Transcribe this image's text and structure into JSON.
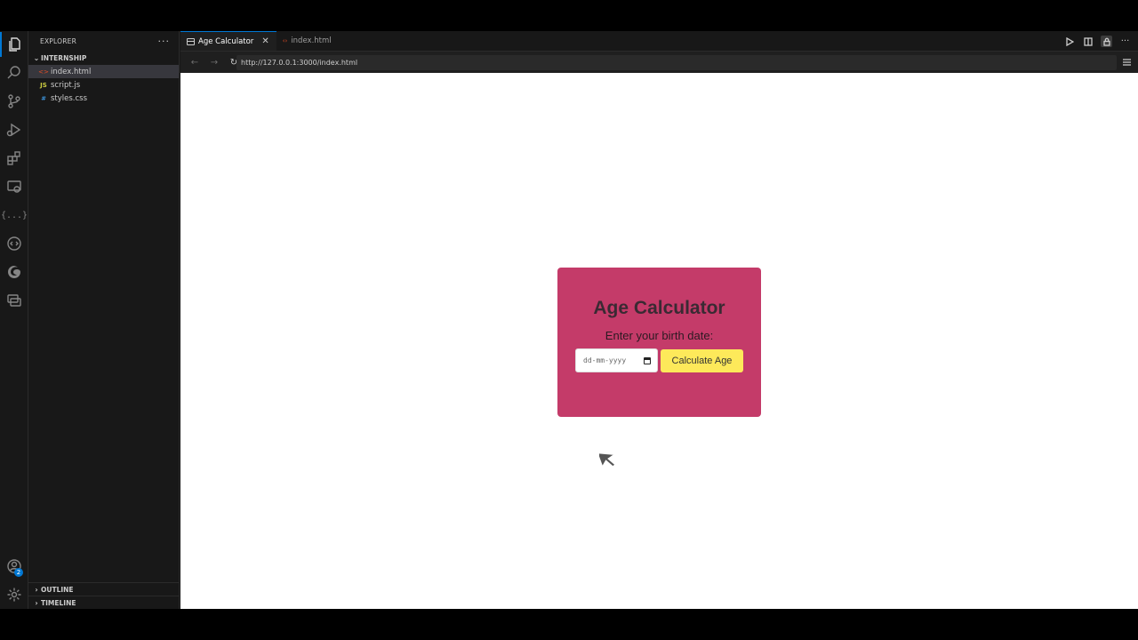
{
  "sidebar": {
    "title": "EXPLORER",
    "more_label": "···",
    "folder": "INTERNSHIP",
    "files": [
      {
        "name": "index.html",
        "icon": "html-file-icon",
        "glyph": "<>"
      },
      {
        "name": "script.js",
        "icon": "js-file-icon",
        "glyph": "JS"
      },
      {
        "name": "styles.css",
        "icon": "css-file-icon",
        "glyph": "#"
      }
    ],
    "outline": "OUTLINE",
    "timeline": "TIMELINE"
  },
  "activity_bar": {
    "items": [
      "explorer-icon",
      "search-icon",
      "source-control-icon",
      "run-debug-icon",
      "extensions-icon",
      "remote-explorer-icon",
      "json-icon",
      "live-share-icon",
      "edge-icon",
      "chat-icon"
    ],
    "json_glyph": "{...}",
    "accounts_badge": "2"
  },
  "tabs": [
    {
      "label": "Age Calculator",
      "active": true,
      "close": "✕"
    },
    {
      "label": "index.html",
      "active": false
    }
  ],
  "browser": {
    "back": "←",
    "forward": "→",
    "reload": "↻",
    "url": "http://127.0.0.1:3000/index.html"
  },
  "page": {
    "title": "Age Calculator",
    "label": "Enter your birth date:",
    "date_placeholder": "dd-mm-yyyy",
    "button": "Calculate Age"
  },
  "colors": {
    "card": "#c43b69",
    "button": "#fde95a",
    "accent": "#0078d4"
  }
}
